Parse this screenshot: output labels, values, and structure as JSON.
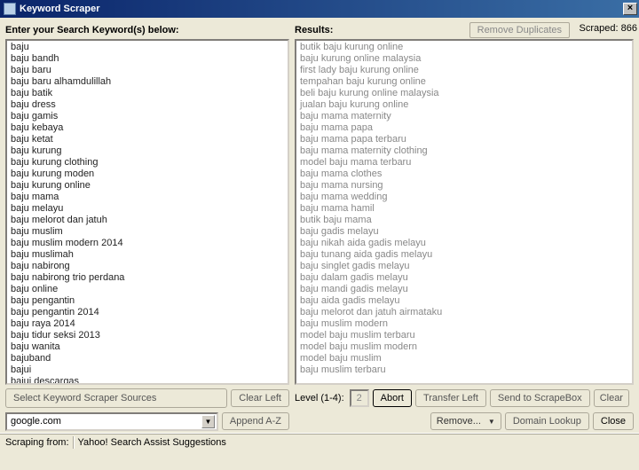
{
  "title": "Keyword Scraper",
  "left": {
    "label": "Enter your Search Keyword(s) below:",
    "items": [
      "baju",
      "baju bandh",
      "baju baru",
      "baju baru alhamdulillah",
      "baju batik",
      "baju dress",
      "baju gamis",
      "baju kebaya",
      "baju ketat",
      "baju kurung",
      "baju kurung clothing",
      "baju kurung moden",
      "baju kurung online",
      "baju mama",
      "baju melayu",
      "baju melorot dan jatuh",
      "baju muslim",
      "baju muslim modern 2014",
      "baju muslimah",
      "baju nabirong",
      "baju nabirong trio perdana",
      "baju online",
      "baju pengantin",
      "baju pengantin 2014",
      "baju raya 2014",
      "baju tidur seksi 2013",
      "baju wanita",
      "bajuband",
      "bajui",
      "bajui descargas"
    ]
  },
  "right": {
    "label": "Results:",
    "remove_dup": "Remove Duplicates",
    "scraped_label": "Scraped:",
    "scraped_count": "866",
    "items": [
      "butik baju kurung online",
      "baju kurung online malaysia",
      "first lady baju kurung online",
      "tempahan baju kurung online",
      "beli baju kurung online malaysia",
      "jualan baju kurung online",
      "baju mama maternity",
      "baju mama papa",
      "baju mama papa terbaru",
      "baju mama maternity clothing",
      "model baju mama terbaru",
      "baju mama clothes",
      "baju mama nursing",
      "baju mama wedding",
      "baju mama hamil",
      "butik baju mama",
      "baju gadis melayu",
      "baju nikah aida gadis melayu",
      "baju tunang aida gadis melayu",
      "baju singlet gadis melayu",
      "baju dalam gadis melayu",
      "baju mandi gadis melayu",
      "baju aida gadis melayu",
      "baju melorot dan jatuh airmataku",
      "baju muslim modern",
      "model baju muslim terbaru",
      "model baju muslim modern",
      "model baju muslim",
      "baju muslim terbaru"
    ]
  },
  "controls": {
    "select_sources": "Select Keyword Scraper Sources",
    "clear_left": "Clear Left",
    "source_value": "google.com",
    "append_az": "Append A-Z",
    "level_label": "Level (1-4):",
    "level_value": "2",
    "abort": "Abort",
    "transfer_left": "Transfer Left",
    "send_scrapebox": "Send to ScrapeBox",
    "clear": "Clear",
    "remove": "Remove...",
    "domain_lookup": "Domain Lookup",
    "close": "Close"
  },
  "status": {
    "scraping_from": "Scraping from:",
    "source": "Yahoo! Search Assist Suggestions"
  }
}
